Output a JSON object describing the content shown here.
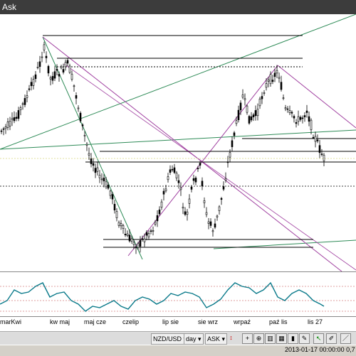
{
  "window": {
    "title": "Ask"
  },
  "chart_data": {
    "type": "candlestick",
    "symbol": "NZD/USD",
    "timeframe": "day",
    "price_side": "ASK",
    "x_ticks": [
      "marKwi",
      "kw maj",
      "maj cze",
      "czelip",
      "lip sie",
      "sie wrz",
      "wrpaź",
      "paź lis",
      "lis 27"
    ],
    "grid": false
  },
  "toolbar": {
    "symbol": "NZD/USD",
    "timeframe": "day",
    "price_side": "ASK"
  },
  "status": {
    "datetime": "2013-01-17 00:00:00  0,7"
  }
}
